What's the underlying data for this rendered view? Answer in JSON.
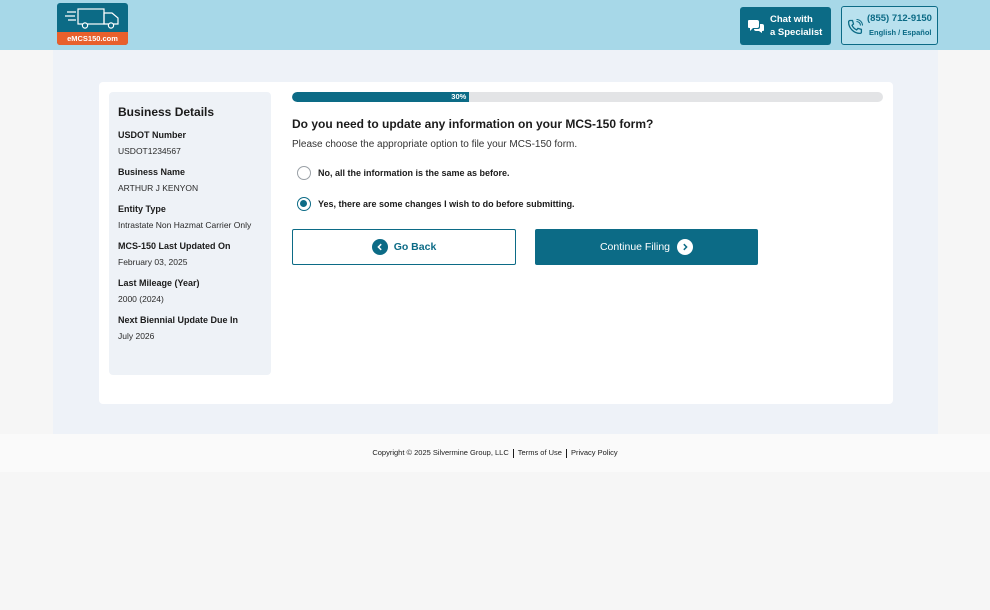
{
  "header": {
    "logo_text": "eMCS150.com",
    "chat_line1": "Chat with",
    "chat_line2": "a Specialist",
    "phone_number": "(855) 712-9150",
    "phone_language": "English / Español"
  },
  "sidebar": {
    "title": "Business Details",
    "fields": [
      {
        "label": "USDOT Number",
        "value": "USDOT1234567"
      },
      {
        "label": "Business Name",
        "value": "ARTHUR J KENYON"
      },
      {
        "label": "Entity Type",
        "value": "Intrastate Non Hazmat Carrier Only"
      },
      {
        "label": "MCS-150 Last Updated On",
        "value": "February 03, 2025"
      },
      {
        "label": "Last Mileage (Year)",
        "value": "2000 (2024)"
      },
      {
        "label": "Next Biennial Update Due In",
        "value": "July 2026"
      }
    ]
  },
  "progress": {
    "label": "30%",
    "fraction": 0.3
  },
  "form": {
    "question": "Do you need to update any information on your MCS-150 form?",
    "instruction": "Please choose the appropriate option to file your MCS-150 form.",
    "options": [
      {
        "label": "No, all the information is the same as before.",
        "selected": false
      },
      {
        "label": "Yes, there are some changes I wish to do before submitting.",
        "selected": true
      }
    ],
    "back_label": "Go Back",
    "continue_label": "Continue Filing"
  },
  "footer": {
    "copyright": "Copyright © 2025 Silvermine Group, LLC",
    "terms": "Terms of Use",
    "privacy": "Privacy Policy"
  },
  "colors": {
    "primary": "#0c6b86",
    "header_bg": "#a7d8e8",
    "logo_accent": "#e8602c"
  }
}
